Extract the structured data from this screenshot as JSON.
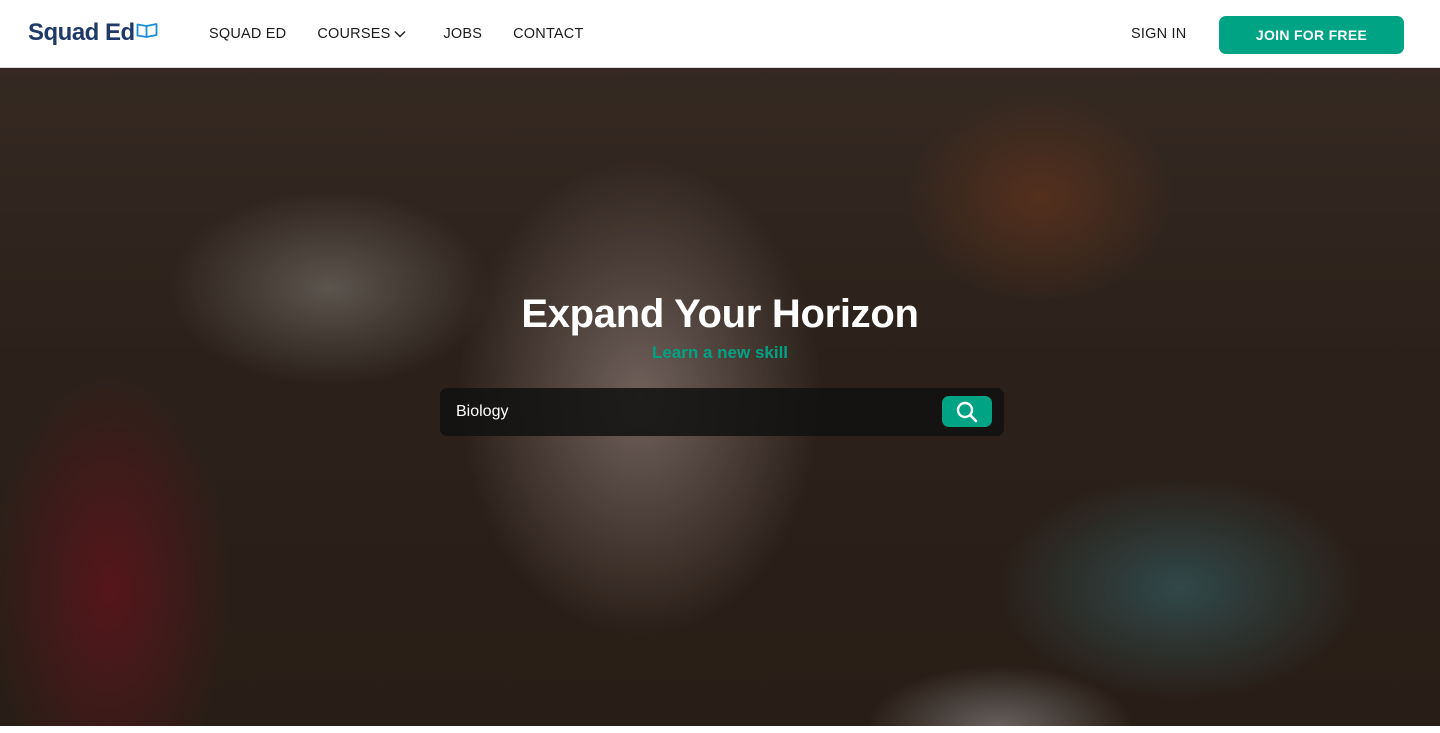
{
  "brand": {
    "name": "Squad Ed",
    "logo_icon": "open-book-icon",
    "color": "#1f3a68"
  },
  "nav": {
    "items": [
      {
        "label": "SQUAD ED"
      },
      {
        "label": "COURSES",
        "icon": "chevron-down-icon"
      },
      {
        "label": "JOBS"
      },
      {
        "label": "CONTACT"
      }
    ],
    "sign_in": "SIGN IN",
    "join": "JOIN FOR FREE"
  },
  "hero": {
    "title": "Expand Your Horizon",
    "subtitle": "Learn a new skill",
    "search": {
      "value": "Biology",
      "icon": "search-icon"
    }
  },
  "colors": {
    "accent": "#00a383",
    "text": "#1b1b1b"
  }
}
